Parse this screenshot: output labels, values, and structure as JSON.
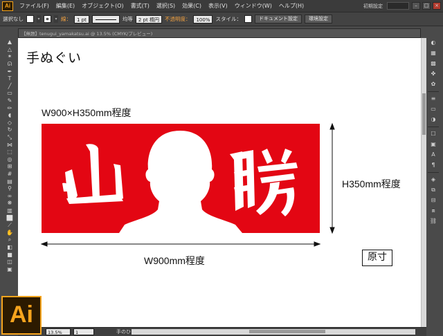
{
  "app": {
    "logo_text": "Ai",
    "workspace": "初期設定"
  },
  "menu": [
    "ファイル(F)",
    "編集(E)",
    "オブジェクト(O)",
    "書式(T)",
    "選択(S)",
    "効果(C)",
    "表示(V)",
    "ウィンドウ(W)",
    "ヘルプ(H)"
  ],
  "control": {
    "selection": "選択なし",
    "stroke_label": "線：",
    "stroke_weight": "1 pt",
    "profile_label": "均等",
    "brush": "2 pt 楕円",
    "opacity_label": "不透明度：",
    "opacity_value": "100%",
    "style_label": "スタイル：",
    "doc_settings": "ドキュメント設定",
    "env_settings": "環境設定"
  },
  "tab": {
    "title": "【無題】tenugui_yamakatsu.ai @ 13.5% (CMYK/プレビュー)"
  },
  "document": {
    "title": "手ぬぐい",
    "size_label": "W900×H350mm程度",
    "banner_left": "山",
    "banner_right": "勝",
    "width_label": "W900mm程度",
    "height_label": "H350mm程度",
    "stamp": "原寸"
  },
  "status": {
    "zoom": "13.5%",
    "page": "1",
    "tool": "手のひら"
  },
  "colors": {
    "banner": "#e30613",
    "ai_orange": "#f7a41d",
    "orange_label": "#f0a040"
  }
}
